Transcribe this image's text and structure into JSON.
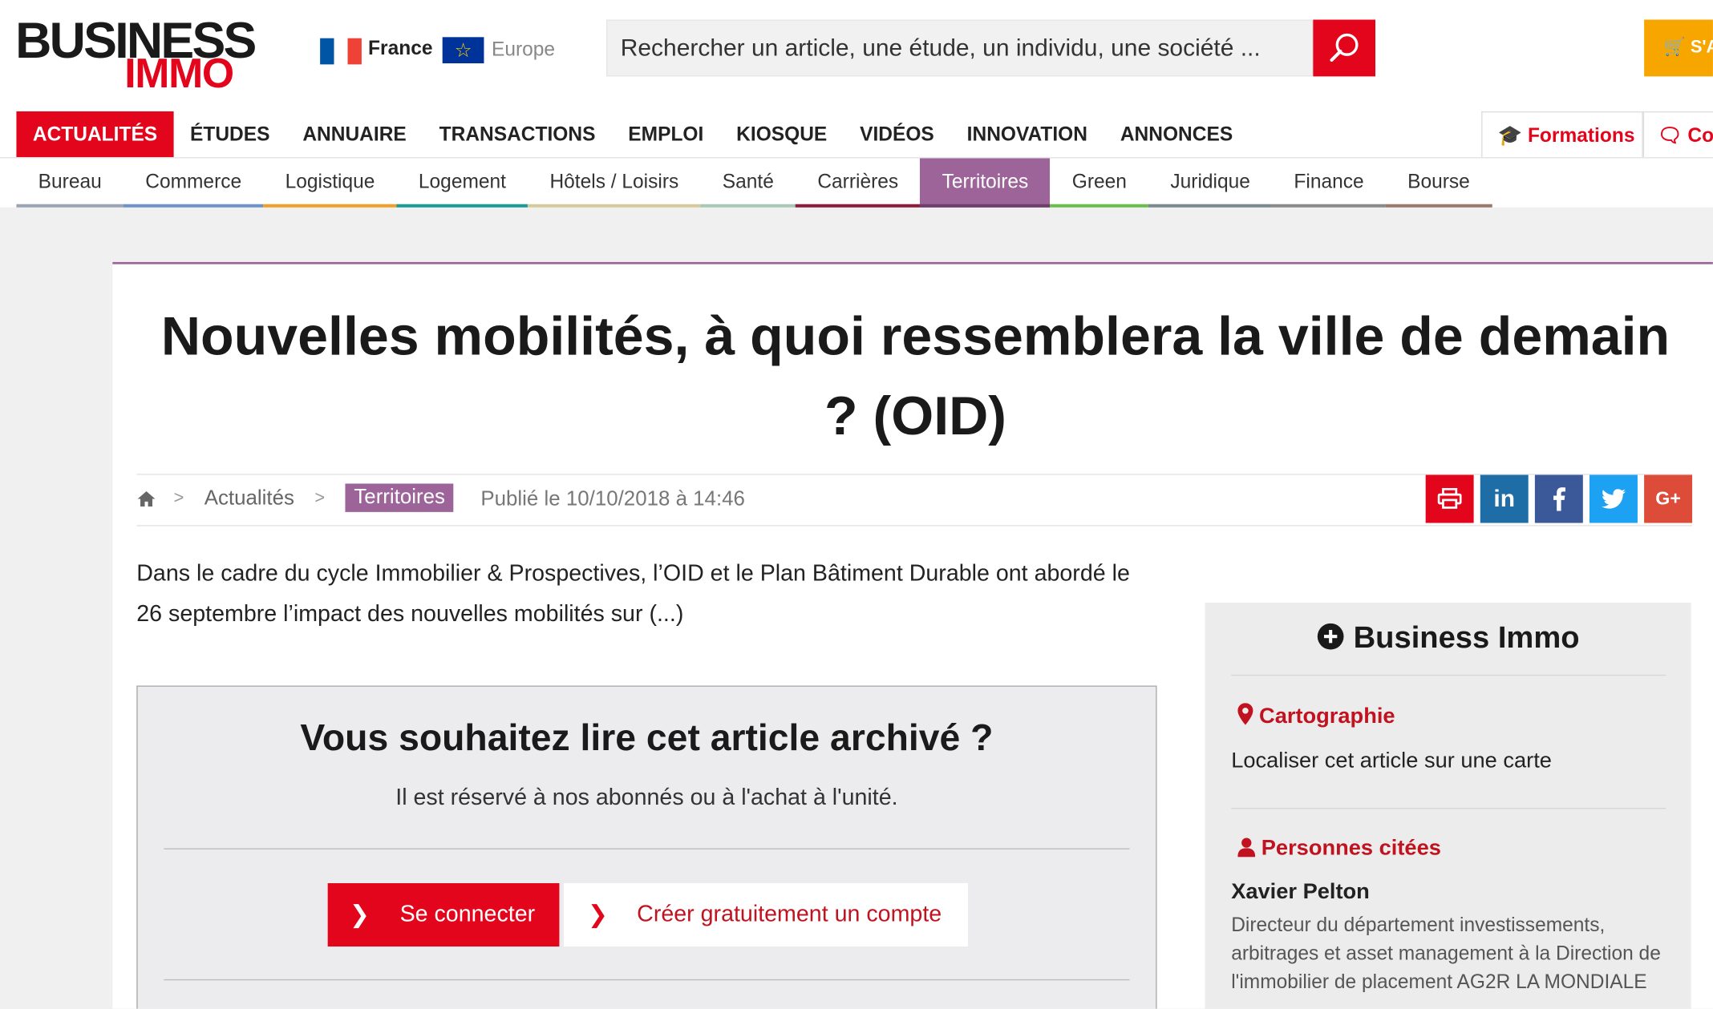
{
  "colors": {
    "brand_red": "#e3051b",
    "territoires_purple": "#9c6499",
    "subscribe_orange": "#f7a600"
  },
  "header": {
    "logo_line1": "BUSINESS",
    "logo_line2": "IMMO",
    "edition_france": "France",
    "edition_europe": "Europe",
    "search_placeholder": "Rechercher un article, une étude, un individu, une société ...",
    "subscribe_label": "S'A"
  },
  "main_nav": [
    "ACTUALITÉS",
    "ÉTUDES",
    "ANNUAIRE",
    "TRANSACTIONS",
    "EMPLOI",
    "KIOSQUE",
    "VIDÉOS",
    "INNOVATION",
    "ANNONCES"
  ],
  "right_nav": {
    "formations": "Formations",
    "contact": "Cor"
  },
  "sub_nav": [
    {
      "label": "Bureau",
      "color": "#9aa4b5"
    },
    {
      "label": "Commerce",
      "color": "#6e93c8"
    },
    {
      "label": "Logistique",
      "color": "#f0a02a"
    },
    {
      "label": "Logement",
      "color": "#1a9a9a"
    },
    {
      "label": "Hôtels / Loisirs",
      "color": "#d6c99a"
    },
    {
      "label": "Santé",
      "color": "#a8c8b8"
    },
    {
      "label": "Carrières",
      "color": "#8e1b3a"
    },
    {
      "label": "Territoires",
      "color": "#6d3f6a"
    },
    {
      "label": "Green",
      "color": "#6abf4b"
    },
    {
      "label": "Juridique",
      "color": "#7a8a8f"
    },
    {
      "label": "Finance",
      "color": "#8a8a8a"
    },
    {
      "label": "Bourse",
      "color": "#9a7a6a"
    }
  ],
  "article": {
    "title": "Nouvelles mobilités, à quoi ressemblera la ville de demain ? (OID)",
    "breadcrumb": {
      "sep": ">",
      "section": "Actualités",
      "category": "Territoires"
    },
    "published": "Publié le 10/10/2018 à 14:46",
    "lead": "Dans le cadre du cycle Immobilier & Prospectives, l’OID et le Plan Bâtiment Durable ont abordé le 26 septembre l’impact des nouvelles mobilités sur (...)"
  },
  "share": {
    "linkedin": "in",
    "google": "G+"
  },
  "paywall": {
    "title": "Vous souhaitez lire cet article archivé ?",
    "subtitle": "Il est réservé à nos abonnés ou à l'achat à l'unité.",
    "login_label": "Se connecter",
    "create_label": "Créer gratuitement un compte"
  },
  "sidebar": {
    "title": "Business Immo",
    "carto_heading": "Cartographie",
    "carto_text": "Localiser cet article sur une carte",
    "people_heading": "Personnes citées",
    "person_name": "Xavier Pelton",
    "person_role": "Directeur du département investissements, arbitrages et asset management à la Direction de l'immobilier de placement AG2R LA MONDIALE"
  }
}
